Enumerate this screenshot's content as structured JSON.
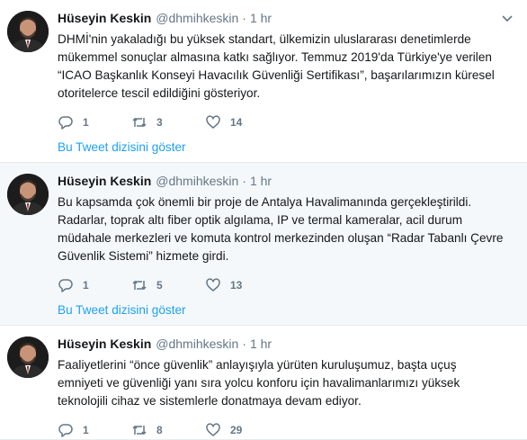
{
  "tweets": [
    {
      "name": "Hüseyin Keskin",
      "handle": "@dhmihkeskin",
      "separator": "·",
      "time": "1 hr",
      "lines": [
        "DHMİ'nin yakaladığı bu yüksek standart, ülkemizin uluslararası denetimlerde",
        "mükemmel sonuçlar almasına katkı sağlıyor. Temmuz 2019'da Türkiye'ye verilen",
        "“ICAO Başkanlık Konseyi Havacılık Güvenliği Sertifikası”, başarılarımızın küresel",
        "otoritelerce tescil edildiğini gösteriyor."
      ],
      "replies": "1",
      "retweets": "3",
      "likes": "14",
      "thread_link": "Bu Tweet dizisini göster"
    },
    {
      "name": "Hüseyin Keskin",
      "handle": "@dhmihkeskin",
      "separator": "·",
      "time": "1 hr",
      "lines": [
        "Bu kapsamda çok önemli bir proje de Antalya Havalimanında gerçekleştirildi.",
        "Radarlar, toprak altı fiber optik algılama, IP ve termal kameralar, acil durum",
        "müdahale merkezleri ve komuta kontrol merkezinden oluşan “Radar Tabanlı Çevre",
        "Güvenlik Sistemi” hizmete girdi."
      ],
      "replies": "1",
      "retweets": "5",
      "likes": "13",
      "thread_link": "Bu Tweet dizisini göster"
    },
    {
      "name": "Hüseyin Keskin",
      "handle": "@dhmihkeskin",
      "separator": "·",
      "time": "1 hr",
      "lines": [
        "Faaliyetlerini “önce güvenlik” anlayışıyla yürüten kuruluşumuz, başta uçuş",
        "emniyeti ve güvenliği yanı sıra yolcu konforu için havalimanlarımızı yüksek",
        "teknolojili cihaz ve sistemlerle donatmaya devam ediyor."
      ],
      "replies": "1",
      "retweets": "8",
      "likes": "29"
    }
  ],
  "icons": {
    "reply": "reply-icon",
    "retweet": "retweet-icon",
    "like": "like-icon",
    "caret": "chevron-down-icon",
    "icon_color": "#657786",
    "link_color": "#1da1f2"
  }
}
